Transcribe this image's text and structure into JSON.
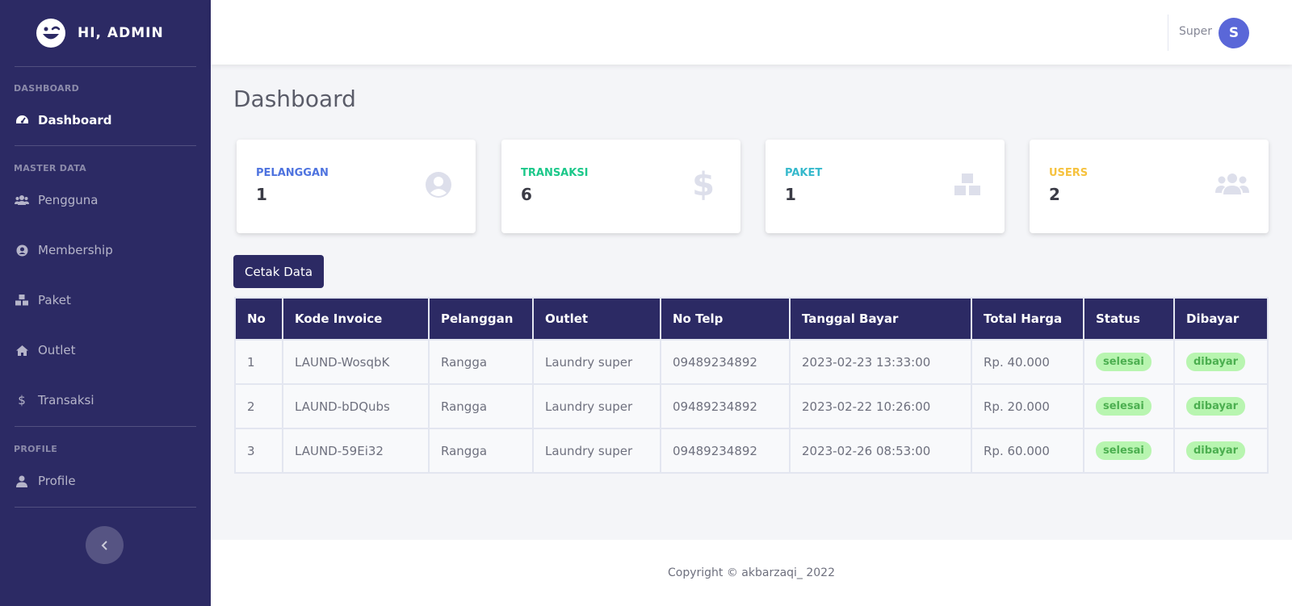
{
  "sidebar": {
    "brand": "HI, ADMIN",
    "sections": {
      "dashboard_heading": "DASHBOARD",
      "master_heading": "MASTER DATA",
      "profile_heading": "PROFILE"
    },
    "items": [
      {
        "label": "Dashboard",
        "icon": "tachometer-icon"
      },
      {
        "label": "Pengguna",
        "icon": "users-icon"
      },
      {
        "label": "Membership",
        "icon": "user-circle-icon"
      },
      {
        "label": "Paket",
        "icon": "cubes-icon"
      },
      {
        "label": "Outlet",
        "icon": "home-icon"
      },
      {
        "label": "Transaksi",
        "icon": "dollar-icon"
      },
      {
        "label": "Profile",
        "icon": "user-icon"
      }
    ]
  },
  "topbar": {
    "username": "Super",
    "avatar_initial": "S"
  },
  "page": {
    "title": "Dashboard"
  },
  "cards": [
    {
      "label": "PELANGGAN",
      "value": "1",
      "color": "#4e73df",
      "icon": "user-circle-icon"
    },
    {
      "label": "TRANSAKSI",
      "value": "6",
      "color": "#1cc88a",
      "icon": "dollar-icon"
    },
    {
      "label": "PAKET",
      "value": "1",
      "color": "#36b9cc",
      "icon": "cubes-icon"
    },
    {
      "label": "USERS",
      "value": "2",
      "color": "#f6c23e",
      "icon": "users-icon"
    }
  ],
  "actions": {
    "print_label": "Cetak Data"
  },
  "table": {
    "headers": [
      "No",
      "Kode Invoice",
      "Pelanggan",
      "Outlet",
      "No Telp",
      "Tanggal Bayar",
      "Total Harga",
      "Status",
      "Dibayar"
    ],
    "rows": [
      [
        "1",
        "LAUND-WosqbK",
        "Rangga",
        "Laundry super",
        "09489234892",
        "2023-02-23 13:33:00",
        "Rp. 40.000",
        "selesai",
        "dibayar"
      ],
      [
        "2",
        "LAUND-bDQubs",
        "Rangga",
        "Laundry super",
        "09489234892",
        "2023-02-22 10:26:00",
        "Rp. 20.000",
        "selesai",
        "dibayar"
      ],
      [
        "3",
        "LAUND-59Ei32",
        "Rangga",
        "Laundry super",
        "09489234892",
        "2023-02-26 08:53:00",
        "Rp. 60.000",
        "selesai",
        "dibayar"
      ]
    ]
  },
  "footer": {
    "copyright": "Copyright © akbarzaqi_ 2022"
  },
  "colors": {
    "sidebar_bg": "#2c2a64",
    "badge_bg": "#b8f5b0",
    "badge_text": "#4caf50"
  }
}
